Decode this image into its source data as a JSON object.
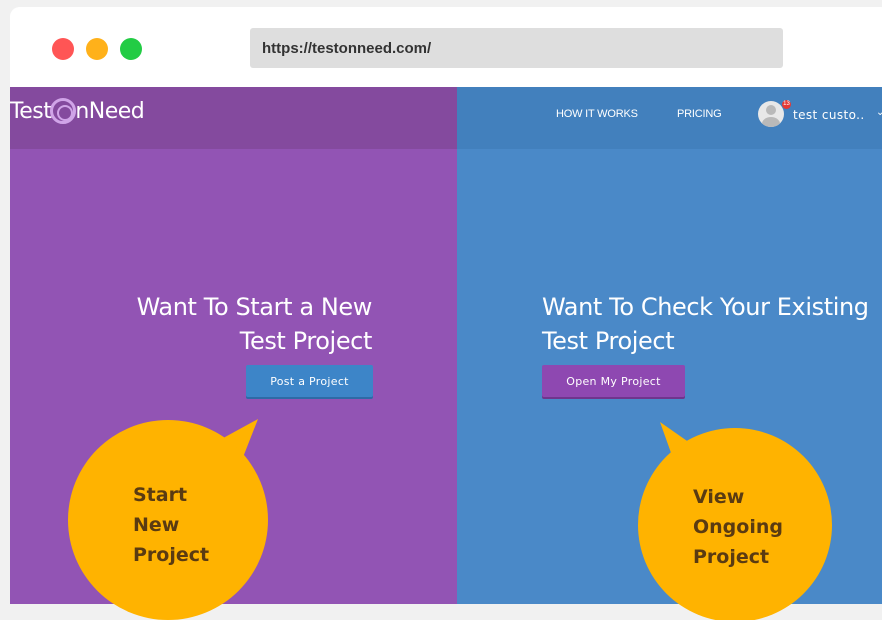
{
  "browser": {
    "url": "https://testonneed.com/"
  },
  "site": {
    "logo_text_left": "Test",
    "logo_text_right": "nNeed",
    "nav": {
      "how_it_works": "HOW IT WORKS",
      "pricing": "PRICING"
    },
    "user": {
      "name": "test custo..",
      "notification_count": "13"
    },
    "left": {
      "heading_line1": "Want To Start a New",
      "heading_line2": "Test Project",
      "button": "Post a Project"
    },
    "right": {
      "heading_line1": "Want To Check Your Existing",
      "heading_line2": "Test Project",
      "button": "Open My Project"
    }
  },
  "callouts": {
    "left": [
      "Start",
      "New",
      "Project"
    ],
    "right": [
      "View",
      "Ongoing",
      "Project"
    ]
  },
  "colors": {
    "purple": "#9254b4",
    "blue": "#4a89c8",
    "callout": "#ffb300"
  }
}
